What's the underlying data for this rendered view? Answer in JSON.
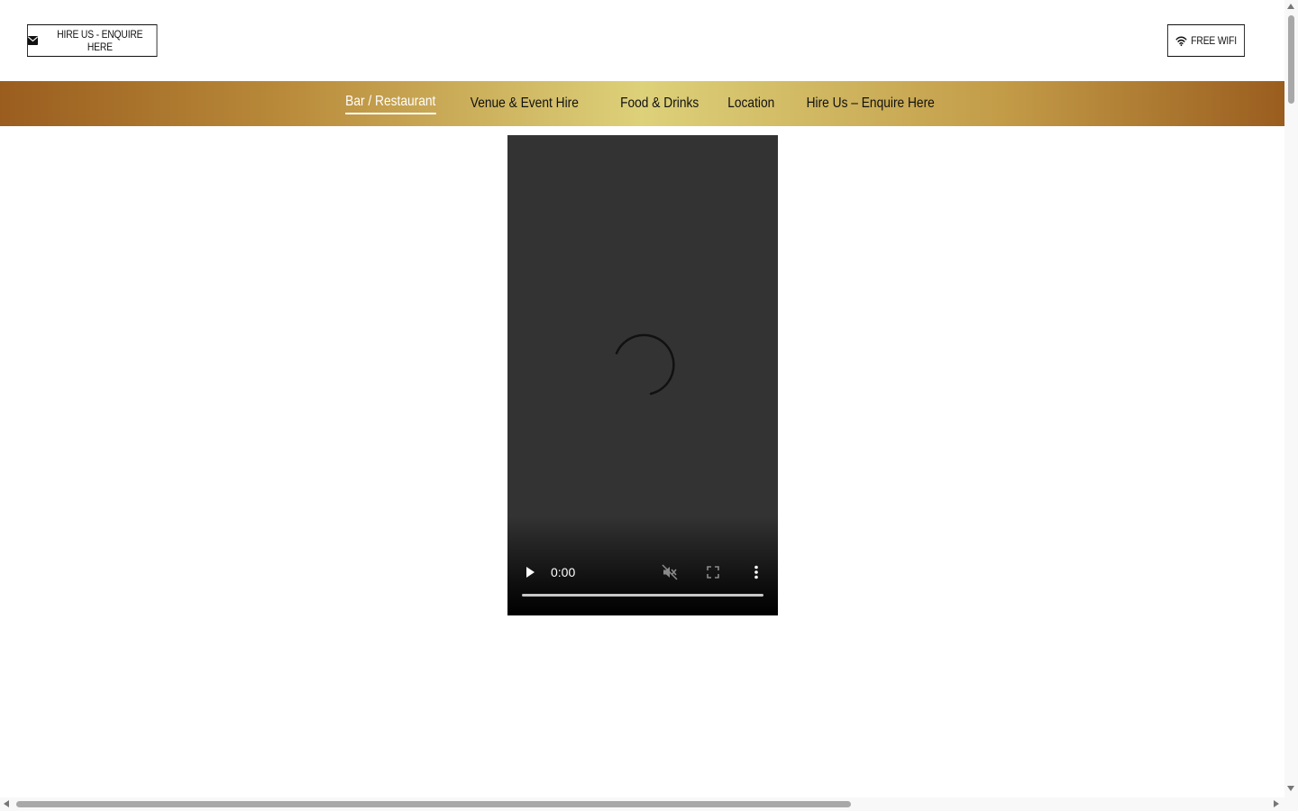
{
  "header": {
    "hire_button_label": "HIRE US - ENQUIRE HERE",
    "hire_button_icon": "envelope-icon",
    "wifi_button_label": "FREE WIFI",
    "wifi_button_icon": "wifi-icon"
  },
  "nav": {
    "gradient_colors": [
      "#9a5d1e",
      "#ddd17a",
      "#9a5d1e"
    ],
    "items": [
      {
        "label": "Bar / Restaurant",
        "active": true
      },
      {
        "label": "Venue & Event Hire",
        "active": false
      },
      {
        "label": "Food & Drinks",
        "active": false
      },
      {
        "label": "Location",
        "active": false
      },
      {
        "label": "Hire Us – Enquire Here",
        "active": false
      }
    ]
  },
  "video": {
    "background": "#333333",
    "state": "loading",
    "time": "0:00",
    "progress": 0,
    "muted": true,
    "icons": [
      "spinner-icon",
      "play-icon",
      "mute-icon",
      "fullscreen-icon",
      "more-vert-icon"
    ]
  }
}
